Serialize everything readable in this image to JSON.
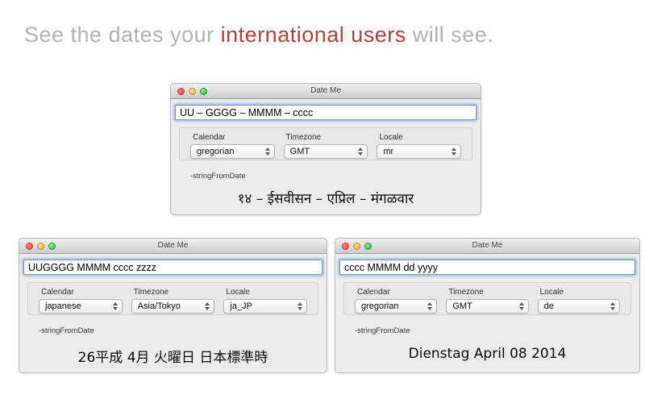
{
  "headline": {
    "prefix": "See the dates your ",
    "highlight": "international users",
    "suffix": " will see."
  },
  "colors": {
    "headline_gray": "#b2b2b2",
    "headline_red": "#a9443e",
    "window_background": "#ebebeb",
    "focus_ring_blue": "#6f9fc8"
  },
  "windows": [
    {
      "title": "Date Me",
      "field_value": "UU – GGGG – MMMM – cccc",
      "calendar_label": "Calendar",
      "calendar_value": "gregorian",
      "timezone_label": "Timezone",
      "timezone_value": "GMT",
      "locale_label": "Locale",
      "locale_value": "mr",
      "method_label": "-stringFromDate",
      "result": "१४ – ईसवीसन – एप्रिल – मंगळवार"
    },
    {
      "title": "Date Me",
      "field_value": "UUGGGG MMMM cccc zzzz",
      "calendar_label": "Calendar",
      "calendar_value": "japanese",
      "timezone_label": "Timezone",
      "timezone_value": "Asia/Tokyo",
      "locale_label": "Locale",
      "locale_value": "ja_JP",
      "method_label": "-stringFromDate",
      "result": "26平成 4月 火曜日 日本標準時"
    },
    {
      "title": "Date Me",
      "field_value": "cccc MMMM dd yyyy",
      "calendar_label": "Calendar",
      "calendar_value": "gregorian",
      "timezone_label": "Timezone",
      "timezone_value": "GMT",
      "locale_label": "Locale",
      "locale_value": "de",
      "method_label": "-stringFromDate",
      "result": "Dienstag April 08 2014"
    }
  ]
}
